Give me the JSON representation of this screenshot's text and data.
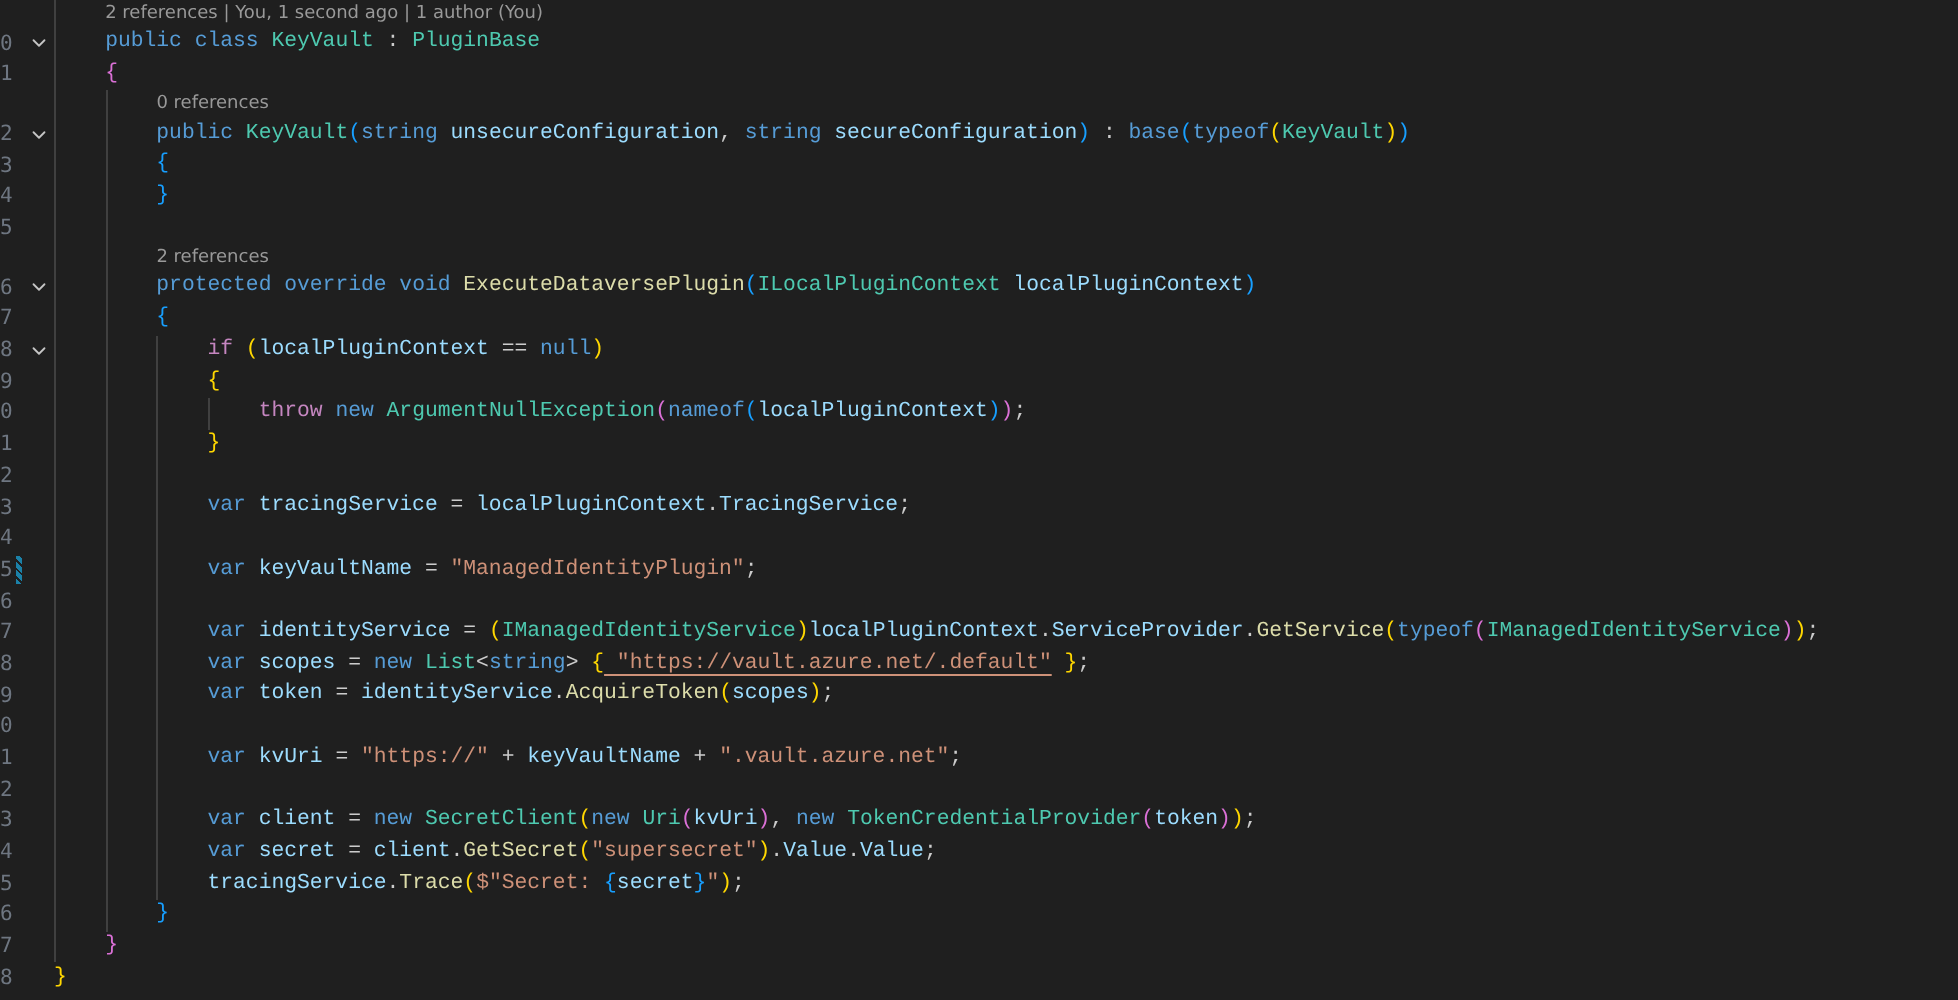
{
  "editor": {
    "rows": [
      {
        "lens": "2 references | You, 1 second ago | 1 author (You)"
      },
      {
        "n": "0",
        "fold": true,
        "code": [
          {
            "text": "    public",
            "color": "#569cd6"
          },
          {
            "text": " class",
            "color": "#569cd6"
          },
          {
            "text": " KeyVault",
            "color": "#4ec9b0"
          },
          {
            "text": " : ",
            "color": "#cccccc"
          },
          {
            "text": "PluginBase",
            "color": "#4ec9b0"
          }
        ]
      },
      {
        "n": "1",
        "code": [
          {
            "text": "    {",
            "color": "#da70d6"
          }
        ]
      },
      {
        "lens": "0 references"
      },
      {
        "n": "2",
        "fold": true,
        "code": [
          {
            "text": "        public",
            "color": "#569cd6"
          },
          {
            "text": " KeyVault",
            "color": "#4ec9b0"
          },
          {
            "text": "(",
            "color": "#179fff"
          },
          {
            "text": "string",
            "color": "#569cd6"
          },
          {
            "text": " unsecureConfiguration",
            "color": "#9cdcfe"
          },
          {
            "text": ", ",
            "color": "#cccccc"
          },
          {
            "text": "string",
            "color": "#569cd6"
          },
          {
            "text": " secureConfiguration",
            "color": "#9cdcfe"
          },
          {
            "text": ")",
            "color": "#179fff"
          },
          {
            "text": " : ",
            "color": "#cccccc"
          },
          {
            "text": "base",
            "color": "#569cd6"
          },
          {
            "text": "(",
            "color": "#179fff"
          },
          {
            "text": "typeof",
            "color": "#569cd6"
          },
          {
            "text": "(",
            "color": "#ffd700"
          },
          {
            "text": "KeyVault",
            "color": "#4ec9b0"
          },
          {
            "text": ")",
            "color": "#ffd700"
          },
          {
            "text": ")",
            "color": "#179fff"
          }
        ]
      },
      {
        "n": "3",
        "code": [
          {
            "text": "        {",
            "color": "#179fff"
          }
        ]
      },
      {
        "n": "4",
        "code": [
          {
            "text": "        }",
            "color": "#179fff"
          }
        ]
      },
      {
        "n": "5",
        "code": []
      },
      {
        "lens": "2 references"
      },
      {
        "n": "6",
        "fold": true,
        "code": [
          {
            "text": "        protected",
            "color": "#569cd6"
          },
          {
            "text": " override",
            "color": "#569cd6"
          },
          {
            "text": " void",
            "color": "#569cd6"
          },
          {
            "text": " ExecuteDataversePlugin",
            "color": "#dcdcaa"
          },
          {
            "text": "(",
            "color": "#179fff"
          },
          {
            "text": "ILocalPluginContext",
            "color": "#4ec9b0"
          },
          {
            "text": " localPluginContext",
            "color": "#9cdcfe"
          },
          {
            "text": ")",
            "color": "#179fff"
          }
        ]
      },
      {
        "n": "7",
        "code": [
          {
            "text": "        {",
            "color": "#179fff"
          }
        ]
      },
      {
        "n": "8",
        "fold": true,
        "code": [
          {
            "text": "            if",
            "color": "#c586c0"
          },
          {
            "text": " (",
            "color": "#ffd700"
          },
          {
            "text": "localPluginContext",
            "color": "#9cdcfe"
          },
          {
            "text": " == ",
            "color": "#cccccc"
          },
          {
            "text": "null",
            "color": "#569cd6"
          },
          {
            "text": ")",
            "color": "#ffd700"
          }
        ]
      },
      {
        "n": "9",
        "code": [
          {
            "text": "            {",
            "color": "#ffd700"
          }
        ]
      },
      {
        "n": "0",
        "code": [
          {
            "text": "                throw",
            "color": "#c586c0"
          },
          {
            "text": " new",
            "color": "#569cd6"
          },
          {
            "text": " ArgumentNullException",
            "color": "#4ec9b0"
          },
          {
            "text": "(",
            "color": "#da70d6"
          },
          {
            "text": "nameof",
            "color": "#569cd6"
          },
          {
            "text": "(",
            "color": "#179fff"
          },
          {
            "text": "localPluginContext",
            "color": "#9cdcfe"
          },
          {
            "text": ")",
            "color": "#179fff"
          },
          {
            "text": ")",
            "color": "#da70d6"
          },
          {
            "text": ";",
            "color": "#cccccc"
          }
        ]
      },
      {
        "n": "1",
        "code": [
          {
            "text": "            }",
            "color": "#ffd700"
          }
        ]
      },
      {
        "n": "2",
        "code": []
      },
      {
        "n": "3",
        "code": [
          {
            "text": "            var",
            "color": "#569cd6"
          },
          {
            "text": " tracingService",
            "color": "#9cdcfe"
          },
          {
            "text": " = ",
            "color": "#cccccc"
          },
          {
            "text": "localPluginContext",
            "color": "#9cdcfe"
          },
          {
            "text": ".",
            "color": "#cccccc"
          },
          {
            "text": "TracingService",
            "color": "#9cdcfe"
          },
          {
            "text": ";",
            "color": "#cccccc"
          }
        ]
      },
      {
        "n": "4",
        "code": []
      },
      {
        "n": "5",
        "modified": true,
        "code": [
          {
            "text": "            var",
            "color": "#569cd6"
          },
          {
            "text": " keyVaultName",
            "color": "#9cdcfe"
          },
          {
            "text": " = ",
            "color": "#cccccc"
          },
          {
            "text": "\"ManagedIdentityPlugin\"",
            "color": "#ce9178"
          },
          {
            "text": ";",
            "color": "#cccccc"
          }
        ]
      },
      {
        "n": "6",
        "code": []
      },
      {
        "n": "7",
        "code": [
          {
            "text": "            var",
            "color": "#569cd6"
          },
          {
            "text": " identityService",
            "color": "#9cdcfe"
          },
          {
            "text": " = ",
            "color": "#cccccc"
          },
          {
            "text": "(",
            "color": "#ffd700"
          },
          {
            "text": "IManagedIdentityService",
            "color": "#4ec9b0"
          },
          {
            "text": ")",
            "color": "#ffd700"
          },
          {
            "text": "localPluginContext",
            "color": "#9cdcfe"
          },
          {
            "text": ".",
            "color": "#cccccc"
          },
          {
            "text": "ServiceProvider",
            "color": "#9cdcfe"
          },
          {
            "text": ".",
            "color": "#cccccc"
          },
          {
            "text": "GetService",
            "color": "#dcdcaa"
          },
          {
            "text": "(",
            "color": "#ffd700"
          },
          {
            "text": "typeof",
            "color": "#569cd6"
          },
          {
            "text": "(",
            "color": "#da70d6"
          },
          {
            "text": "IManagedIdentityService",
            "color": "#4ec9b0"
          },
          {
            "text": ")",
            "color": "#da70d6"
          },
          {
            "text": ")",
            "color": "#ffd700"
          },
          {
            "text": ";",
            "color": "#cccccc"
          }
        ]
      },
      {
        "n": "8",
        "code": [
          {
            "text": "            var",
            "color": "#569cd6"
          },
          {
            "text": " scopes",
            "color": "#9cdcfe"
          },
          {
            "text": " = ",
            "color": "#cccccc"
          },
          {
            "text": "new",
            "color": "#569cd6"
          },
          {
            "text": " List",
            "color": "#4ec9b0"
          },
          {
            "text": "<",
            "color": "#cccccc"
          },
          {
            "text": "string",
            "color": "#569cd6"
          },
          {
            "text": ">",
            "color": "#cccccc"
          },
          {
            "text": " {",
            "color": "#ffd700"
          },
          {
            "text": " \"https://vault.azure.net/.default\"",
            "color": "#ce9178",
            "underlined": true
          },
          {
            "text": " }",
            "color": "#ffd700"
          },
          {
            "text": ";",
            "color": "#cccccc"
          }
        ]
      },
      {
        "n": "9",
        "code": [
          {
            "text": "            var",
            "color": "#569cd6"
          },
          {
            "text": " token",
            "color": "#9cdcfe"
          },
          {
            "text": " = ",
            "color": "#cccccc"
          },
          {
            "text": "identityService",
            "color": "#9cdcfe"
          },
          {
            "text": ".",
            "color": "#cccccc"
          },
          {
            "text": "AcquireToken",
            "color": "#dcdcaa"
          },
          {
            "text": "(",
            "color": "#ffd700"
          },
          {
            "text": "scopes",
            "color": "#9cdcfe"
          },
          {
            "text": ")",
            "color": "#ffd700"
          },
          {
            "text": ";",
            "color": "#cccccc"
          }
        ]
      },
      {
        "n": "0",
        "code": []
      },
      {
        "n": "1",
        "code": [
          {
            "text": "            var",
            "color": "#569cd6"
          },
          {
            "text": " kvUri",
            "color": "#9cdcfe"
          },
          {
            "text": " = ",
            "color": "#cccccc"
          },
          {
            "text": "\"https://\"",
            "color": "#ce9178"
          },
          {
            "text": " + ",
            "color": "#cccccc"
          },
          {
            "text": "keyVaultName",
            "color": "#9cdcfe"
          },
          {
            "text": " + ",
            "color": "#cccccc"
          },
          {
            "text": "\".vault.azure.net\"",
            "color": "#ce9178"
          },
          {
            "text": ";",
            "color": "#cccccc"
          }
        ]
      },
      {
        "n": "2",
        "code": []
      },
      {
        "n": "3",
        "code": [
          {
            "text": "            var",
            "color": "#569cd6"
          },
          {
            "text": " client",
            "color": "#9cdcfe"
          },
          {
            "text": " = ",
            "color": "#cccccc"
          },
          {
            "text": "new",
            "color": "#569cd6"
          },
          {
            "text": " SecretClient",
            "color": "#4ec9b0"
          },
          {
            "text": "(",
            "color": "#ffd700"
          },
          {
            "text": "new",
            "color": "#569cd6"
          },
          {
            "text": " Uri",
            "color": "#4ec9b0"
          },
          {
            "text": "(",
            "color": "#da70d6"
          },
          {
            "text": "kvUri",
            "color": "#9cdcfe"
          },
          {
            "text": ")",
            "color": "#da70d6"
          },
          {
            "text": ", ",
            "color": "#cccccc"
          },
          {
            "text": "new",
            "color": "#569cd6"
          },
          {
            "text": " TokenCredentialProvider",
            "color": "#4ec9b0"
          },
          {
            "text": "(",
            "color": "#da70d6"
          },
          {
            "text": "token",
            "color": "#9cdcfe"
          },
          {
            "text": ")",
            "color": "#da70d6"
          },
          {
            "text": ")",
            "color": "#ffd700"
          },
          {
            "text": ";",
            "color": "#cccccc"
          }
        ]
      },
      {
        "n": "4",
        "code": [
          {
            "text": "            var",
            "color": "#569cd6"
          },
          {
            "text": " secret",
            "color": "#9cdcfe"
          },
          {
            "text": " = ",
            "color": "#cccccc"
          },
          {
            "text": "client",
            "color": "#9cdcfe"
          },
          {
            "text": ".",
            "color": "#cccccc"
          },
          {
            "text": "GetSecret",
            "color": "#dcdcaa"
          },
          {
            "text": "(",
            "color": "#ffd700"
          },
          {
            "text": "\"supersecret\"",
            "color": "#ce9178"
          },
          {
            "text": ")",
            "color": "#ffd700"
          },
          {
            "text": ".",
            "color": "#cccccc"
          },
          {
            "text": "Value",
            "color": "#9cdcfe"
          },
          {
            "text": ".",
            "color": "#cccccc"
          },
          {
            "text": "Value",
            "color": "#9cdcfe"
          },
          {
            "text": ";",
            "color": "#cccccc"
          }
        ]
      },
      {
        "n": "5",
        "code": [
          {
            "text": "            tracingService",
            "color": "#9cdcfe"
          },
          {
            "text": ".",
            "color": "#cccccc"
          },
          {
            "text": "Trace",
            "color": "#dcdcaa"
          },
          {
            "text": "(",
            "color": "#ffd700"
          },
          {
            "text": "$\"Secret: ",
            "color": "#ce9178"
          },
          {
            "text": "{",
            "color": "#179fff"
          },
          {
            "text": "secret",
            "color": "#9cdcfe"
          },
          {
            "text": "}",
            "color": "#179fff"
          },
          {
            "text": "\"",
            "color": "#ce9178"
          },
          {
            "text": ")",
            "color": "#ffd700"
          },
          {
            "text": ";",
            "color": "#cccccc"
          }
        ]
      },
      {
        "n": "6",
        "code": [
          {
            "text": "        }",
            "color": "#179fff"
          }
        ]
      },
      {
        "n": "7",
        "code": [
          {
            "text": "    }",
            "color": "#da70d6"
          }
        ]
      },
      {
        "n": "8",
        "code": [
          {
            "text": "}",
            "color": "#ffd700"
          }
        ]
      }
    ]
  }
}
